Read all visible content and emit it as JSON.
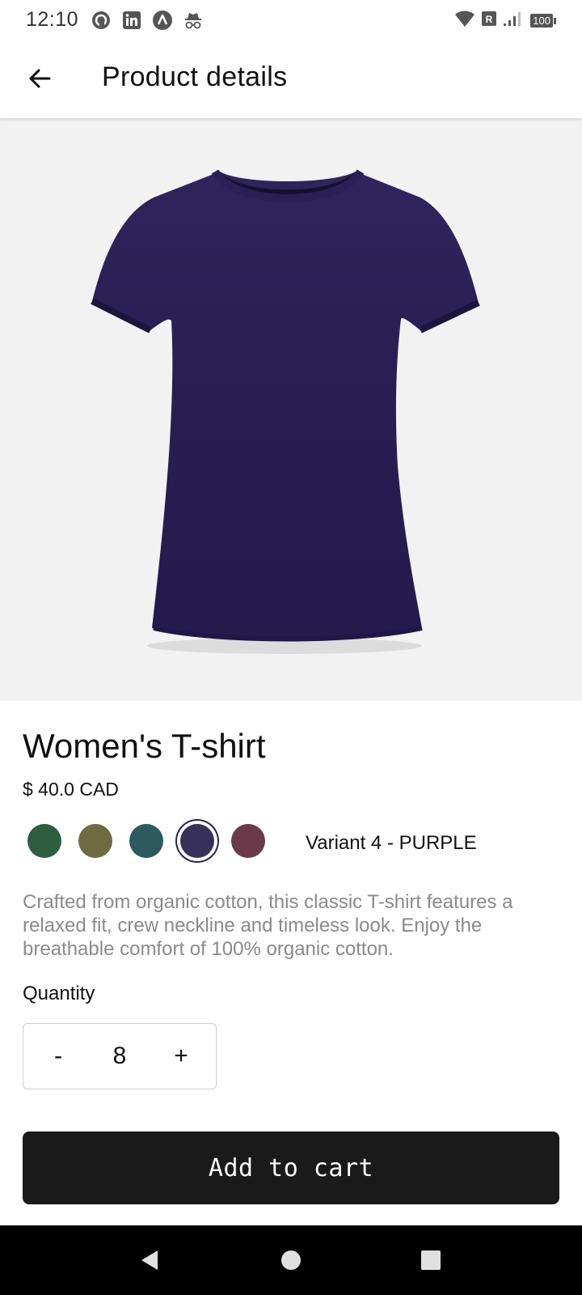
{
  "status_bar": {
    "time": "12:10",
    "left_icons": [
      "pocket-casts-icon",
      "linkedin-icon",
      "app-a-icon",
      "incognito-icon"
    ],
    "right_icons": [
      "wifi-icon",
      "roaming-icon",
      "signal-icon",
      "battery-icon"
    ],
    "battery": "100"
  },
  "app_bar": {
    "title": "Product details",
    "back_icon": "arrow-left-icon"
  },
  "product": {
    "name": "Women's T-shirt",
    "price": "$ 40.0 CAD",
    "description": "Crafted from organic cotton, this classic T-shirt features a relaxed fit, crew neckline and timeless look. Enjoy the breathable comfort of 100% organic cotton.",
    "image_color": "#2c2156",
    "variants": [
      {
        "color": "#2e5e40",
        "selected": false
      },
      {
        "color": "#6e6a42",
        "selected": false
      },
      {
        "color": "#2c5a5f",
        "selected": false
      },
      {
        "color": "#37305a",
        "selected": true
      },
      {
        "color": "#6b3a4a",
        "selected": false
      }
    ],
    "selected_variant_label": "Variant 4 - PURPLE"
  },
  "quantity": {
    "label": "Quantity",
    "value": "8",
    "decrement_label": "-",
    "increment_label": "+"
  },
  "cart": {
    "button_label": "Add to cart",
    "button_color": "#1a1a1a"
  },
  "nav_bar": {
    "icons": [
      "nav-back-icon",
      "nav-home-icon",
      "nav-recents-icon"
    ]
  }
}
